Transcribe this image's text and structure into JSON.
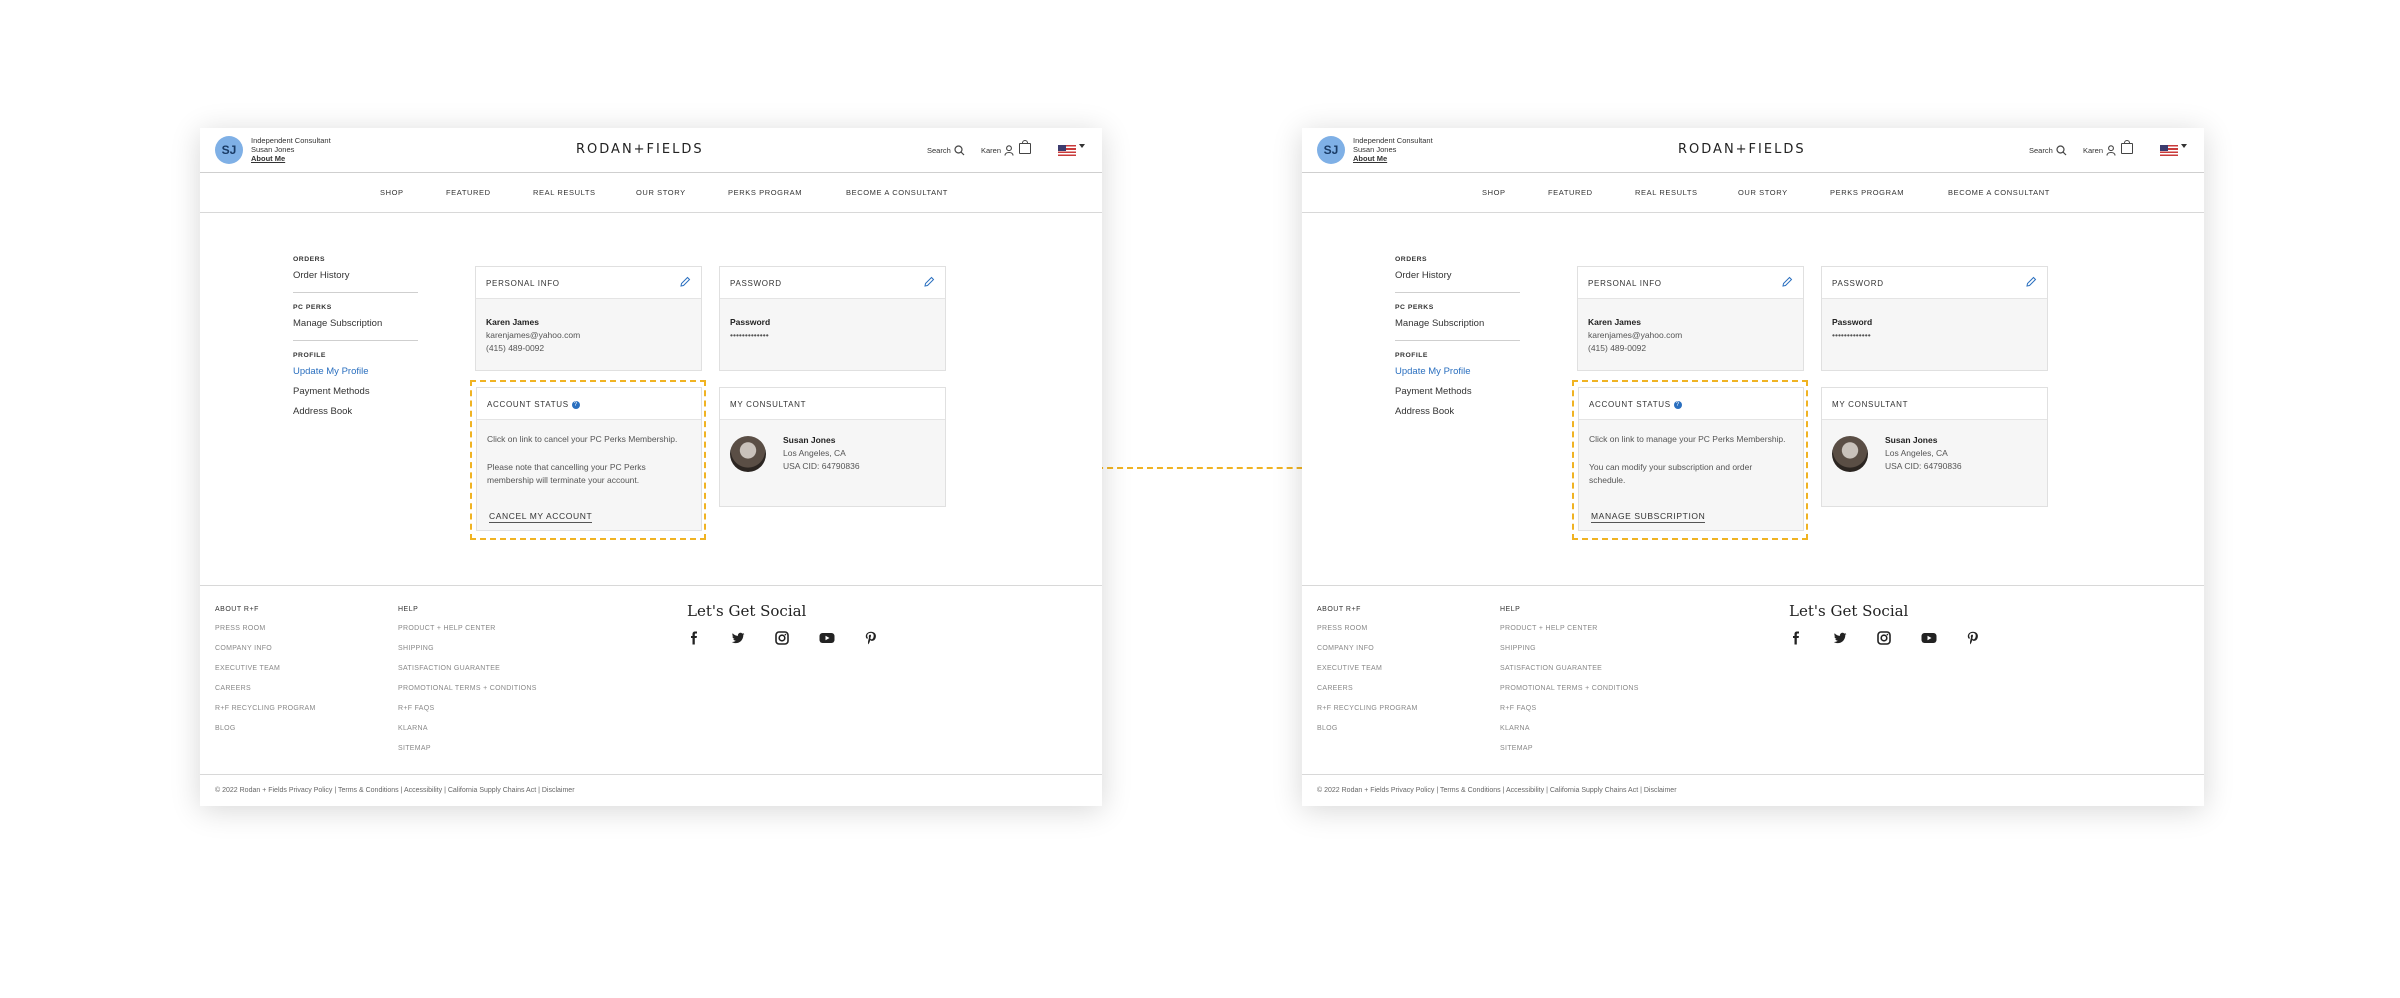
{
  "colors": {
    "accent": "#2a6fbf",
    "highlight": "#f0b323",
    "text": "#333333",
    "muted": "#888888"
  },
  "panels": [
    {
      "header": {
        "avatar_initials": "SJ",
        "consultant_role": "Independent Consultant",
        "consultant_name": "Susan Jones",
        "about_me": "About Me",
        "logo": "RODAN+FIELDS",
        "search_label": "Search",
        "user_label": "Karen",
        "icons": [
          "search-icon",
          "user-icon",
          "bag-icon",
          "us-flag-icon"
        ]
      },
      "nav": [
        "SHOP",
        "FEATURED",
        "REAL RESULTS",
        "OUR STORY",
        "PERKS PROGRAM",
        "BECOME A CONSULTANT"
      ],
      "sidebar": {
        "orders_head": "ORDERS",
        "order_history": "Order History",
        "perks_head": "PC PERKS",
        "manage_subscription": "Manage Subscription",
        "profile_head": "PROFILE",
        "update_profile": "Update My Profile",
        "payment_methods": "Payment Methods",
        "address_book": "Address Book"
      },
      "personal_info": {
        "title": "PERSONAL INFO",
        "name": "Karen James",
        "email": "karenjames@yahoo.com",
        "phone": "(415) 489-0092"
      },
      "password": {
        "title": "PASSWORD",
        "label": "Password",
        "value": "•••••••••••••"
      },
      "account_status": {
        "title": "ACCOUNT STATUS",
        "line1": "Click on link to cancel your PC Perks Membership.",
        "line2": "Please note that cancelling your PC Perks membership will terminate your account.",
        "link": "CANCEL MY ACCOUNT"
      },
      "consultant": {
        "title": "MY CONSULTANT",
        "name": "Susan Jones",
        "location": "Los Angeles, CA",
        "cid": "USA CID: 64790836"
      },
      "footer": {
        "about_head": "ABOUT R+F",
        "about_links": [
          "PRESS ROOM",
          "COMPANY INFO",
          "EXECUTIVE TEAM",
          "CAREERS",
          "R+F RECYCLING PROGRAM",
          "BLOG"
        ],
        "help_head": "HELP",
        "help_links": [
          "PRODUCT + HELP CENTER",
          "SHIPPING",
          "SATISFACTION GUARANTEE",
          "PROMOTIONAL TERMS + CONDITIONS",
          "R+F FAQS",
          "KLARNA",
          "SITEMAP"
        ],
        "social_title": "Let's Get Social",
        "social_icons": [
          "facebook-icon",
          "twitter-icon",
          "instagram-icon",
          "youtube-icon",
          "pinterest-icon"
        ],
        "copyright": "© 2022 Rodan + Fields Privacy Policy  |  Terms & Conditions  |  Accessibility  |  California Supply Chains Act  |  Disclaimer"
      }
    },
    {
      "header": {
        "avatar_initials": "SJ",
        "consultant_role": "Independent Consultant",
        "consultant_name": "Susan Jones",
        "about_me": "About Me",
        "logo": "RODAN+FIELDS",
        "search_label": "Search",
        "user_label": "Karen",
        "icons": [
          "search-icon",
          "user-icon",
          "bag-icon",
          "us-flag-icon"
        ]
      },
      "nav": [
        "SHOP",
        "FEATURED",
        "REAL RESULTS",
        "OUR STORY",
        "PERKS PROGRAM",
        "BECOME A CONSULTANT"
      ],
      "sidebar": {
        "orders_head": "ORDERS",
        "order_history": "Order History",
        "perks_head": "PC PERKS",
        "manage_subscription": "Manage Subscription",
        "profile_head": "PROFILE",
        "update_profile": "Update My Profile",
        "payment_methods": "Payment Methods",
        "address_book": "Address Book"
      },
      "personal_info": {
        "title": "PERSONAL INFO",
        "name": "Karen James",
        "email": "karenjames@yahoo.com",
        "phone": "(415) 489-0092"
      },
      "password": {
        "title": "PASSWORD",
        "label": "Password",
        "value": "•••••••••••••"
      },
      "account_status": {
        "title": "ACCOUNT STATUS",
        "line1": "Click on link to manage your PC Perks Membership.",
        "line2": "You can modify your subscription and order schedule.",
        "link": "MANAGE SUBSCRIPTION"
      },
      "consultant": {
        "title": "MY CONSULTANT",
        "name": "Susan Jones",
        "location": "Los Angeles, CA",
        "cid": "USA CID: 64790836"
      },
      "footer": {
        "about_head": "ABOUT R+F",
        "about_links": [
          "PRESS ROOM",
          "COMPANY INFO",
          "EXECUTIVE TEAM",
          "CAREERS",
          "R+F RECYCLING PROGRAM",
          "BLOG"
        ],
        "help_head": "HELP",
        "help_links": [
          "PRODUCT + HELP CENTER",
          "SHIPPING",
          "SATISFACTION GUARANTEE",
          "PROMOTIONAL TERMS + CONDITIONS",
          "R+F FAQS",
          "KLARNA",
          "SITEMAP"
        ],
        "social_title": "Let's Get Social",
        "social_icons": [
          "facebook-icon",
          "twitter-icon",
          "instagram-icon",
          "youtube-icon",
          "pinterest-icon"
        ],
        "copyright": "© 2022 Rodan + Fields Privacy Policy  |  Terms & Conditions  |  Accessibility  |  California Supply Chains Act  |  Disclaimer"
      }
    }
  ]
}
